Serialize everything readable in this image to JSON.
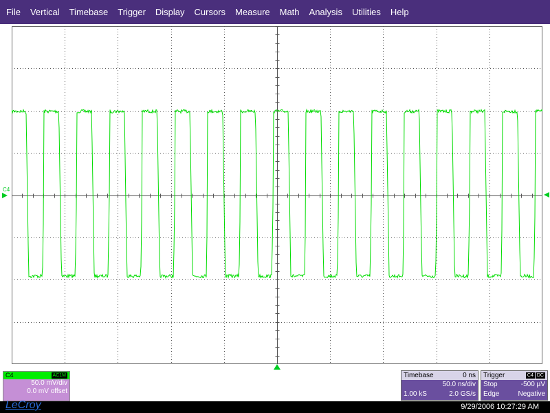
{
  "menu": [
    "File",
    "Vertical",
    "Timebase",
    "Trigger",
    "Display",
    "Cursors",
    "Measure",
    "Math",
    "Analysis",
    "Utilities",
    "Help"
  ],
  "trace": {
    "channel": "C4",
    "color": "#00dd00",
    "cycles": 16.2,
    "high_level_mV": 100,
    "low_level_mV": -95
  },
  "channel_box": {
    "name": "C4",
    "coupling": "AC1M",
    "scale": "50.0 mV/div",
    "offset": "0.0 mV offset",
    "color": "#c58fd6"
  },
  "timebase": {
    "title": "Timebase",
    "delay": "0 ns",
    "scale": "50.0 ns/div",
    "samples": "1.00 kS",
    "rate": "2.0 GS/s"
  },
  "trigger": {
    "title": "Trigger",
    "source": "C4",
    "coupling": "DC",
    "mode": "Stop",
    "level": "-500 µV",
    "type": "Edge",
    "slope": "Negative"
  },
  "status": {
    "brand": "LeCroy",
    "timestamp": "9/29/2006 10:27:29 AM"
  },
  "colors": {
    "menubar": "#4a2f7c",
    "grid": "#555555",
    "trace": "#00dd00"
  }
}
